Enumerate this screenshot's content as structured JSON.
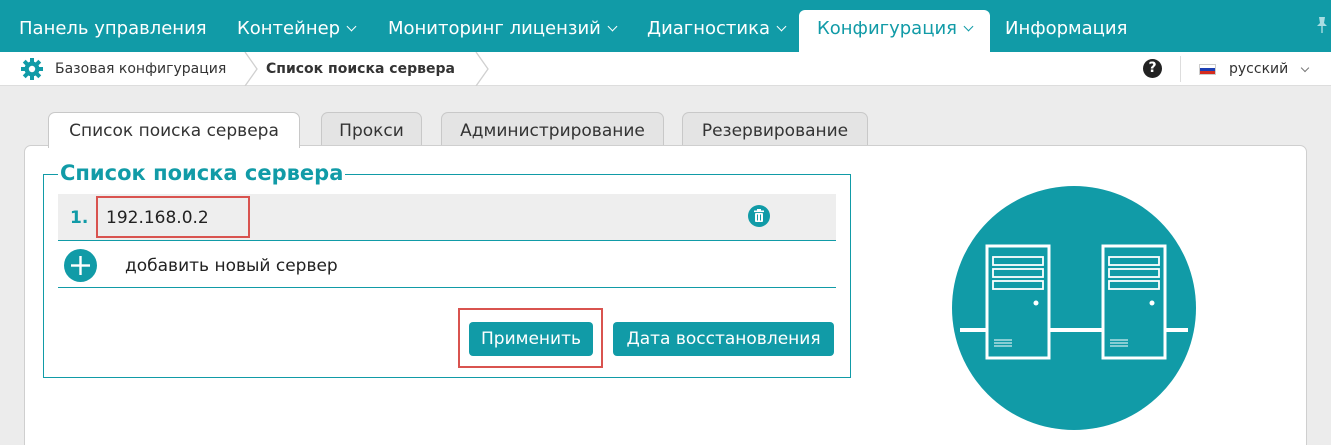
{
  "nav": {
    "items": [
      {
        "label": "Панель управления",
        "chevron": false
      },
      {
        "label": "Контейнер",
        "chevron": true
      },
      {
        "label": "Мониторинг лицензий",
        "chevron": true
      },
      {
        "label": "Диагностика",
        "chevron": true
      },
      {
        "label": "Конфигурация",
        "chevron": true,
        "active": true
      },
      {
        "label": "Информация",
        "chevron": false
      }
    ]
  },
  "breadcrumb": {
    "items": [
      "Базовая конфигурация",
      "Список поиска сервера"
    ]
  },
  "lang": {
    "label": "русский"
  },
  "help": {
    "label": "?"
  },
  "tabs": [
    {
      "label": "Список поиска сервера",
      "active": true
    },
    {
      "label": "Прокси"
    },
    {
      "label": "Администрирование"
    },
    {
      "label": "Резервирование"
    }
  ],
  "server_list": {
    "legend": "Список поиска сервера",
    "rows": [
      {
        "num": "1.",
        "value": "192.168.0.2"
      }
    ],
    "add_label": "добавить новый сервер",
    "apply_label": "Применить",
    "restore_label": "Дата восстановления"
  },
  "colors": {
    "accent": "#119ba7",
    "highlight": "#d9534f"
  },
  "icons": [
    "gear-icon",
    "help-icon",
    "flag-icon",
    "trash-icon",
    "plus-icon",
    "pin-icon",
    "server-network-illustration"
  ]
}
